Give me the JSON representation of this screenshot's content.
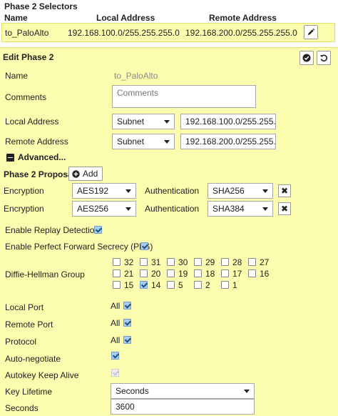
{
  "selectors": {
    "title": "Phase 2 Selectors",
    "headers": {
      "name": "Name",
      "local": "Local Address",
      "remote": "Remote Address"
    },
    "row": {
      "name": "to_PaloAlto",
      "local": "192.168.100.0/255.255.255.0",
      "remote": "192.168.200.0/255.255.255.0"
    }
  },
  "edit": {
    "title": "Edit Phase 2",
    "name_label": "Name",
    "name_value": "to_PaloAlto",
    "comments_label": "Comments",
    "comments_placeholder": "Comments",
    "local_label": "Local Address",
    "local_type": "Subnet",
    "local_value": "192.168.100.0/255.255.",
    "remote_label": "Remote Address",
    "remote_type": "Subnet",
    "remote_value": "192.168.200.0/255.255.",
    "advanced_label": "Advanced...",
    "proposal_label": "Phase 2 Proposal",
    "add_label": "Add",
    "proposals": [
      {
        "enc_label": "Encryption",
        "enc": "AES192",
        "auth_label": "Authentication",
        "auth": "SHA256"
      },
      {
        "enc_label": "Encryption",
        "enc": "AES256",
        "auth_label": "Authentication",
        "auth": "SHA384"
      }
    ],
    "replay_label": "Enable Replay Detection",
    "pfs_label": "Enable Perfect Forward Secrecy (PFS)",
    "dh_label": "Diffie-Hellman Group",
    "dh_groups": [
      "32",
      "31",
      "30",
      "29",
      "28",
      "27",
      "21",
      "20",
      "19",
      "18",
      "17",
      "16",
      "15",
      "14",
      "5",
      "2",
      "1"
    ],
    "dh_checked": [
      "14"
    ],
    "local_port_label": "Local Port",
    "remote_port_label": "Remote Port",
    "protocol_label": "Protocol",
    "all_text": "All",
    "autoneg_label": "Auto-negotiate",
    "keepalive_label": "Autokey Keep Alive",
    "key_lifetime_label": "Key Lifetime",
    "key_lifetime_value": "Seconds",
    "seconds_label": "Seconds",
    "seconds_value": "3600"
  }
}
